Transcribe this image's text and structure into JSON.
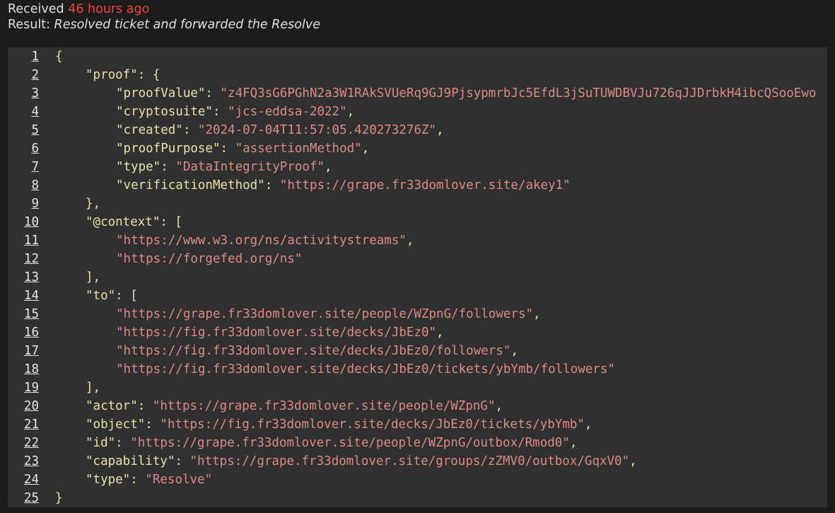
{
  "header": {
    "received_label": "Received",
    "received_time": "46 hours ago",
    "result_label": "Result:",
    "result_value": "Resolved ticket and forwarded the Resolve"
  },
  "code": {
    "lines": [
      {
        "n": "1",
        "indent": 0,
        "parts": [
          [
            "p",
            "{"
          ]
        ]
      },
      {
        "n": "2",
        "indent": 1,
        "parts": [
          [
            "k",
            "\"proof\""
          ],
          [
            "p",
            ": {"
          ]
        ]
      },
      {
        "n": "3",
        "indent": 2,
        "parts": [
          [
            "k",
            "\"proofValue\""
          ],
          [
            "p",
            ": "
          ],
          [
            "s",
            "\"z4FQ3sG6PGhN2a3W1RAkSVUeRq9GJ9PjsypmrbJc5EfdL3jSuTUWDBVJu726qJJDrbkH4ibcQSooEwo"
          ]
        ]
      },
      {
        "n": "4",
        "indent": 2,
        "parts": [
          [
            "k",
            "\"cryptosuite\""
          ],
          [
            "p",
            ": "
          ],
          [
            "s",
            "\"jcs-eddsa-2022\""
          ],
          [
            "p",
            ","
          ]
        ]
      },
      {
        "n": "5",
        "indent": 2,
        "parts": [
          [
            "k",
            "\"created\""
          ],
          [
            "p",
            ": "
          ],
          [
            "s",
            "\"2024-07-04T11:57:05.420273276Z\""
          ],
          [
            "p",
            ","
          ]
        ]
      },
      {
        "n": "6",
        "indent": 2,
        "parts": [
          [
            "k",
            "\"proofPurpose\""
          ],
          [
            "p",
            ": "
          ],
          [
            "s",
            "\"assertionMethod\""
          ],
          [
            "p",
            ","
          ]
        ]
      },
      {
        "n": "7",
        "indent": 2,
        "parts": [
          [
            "k",
            "\"type\""
          ],
          [
            "p",
            ": "
          ],
          [
            "s",
            "\"DataIntegrityProof\""
          ],
          [
            "p",
            ","
          ]
        ]
      },
      {
        "n": "8",
        "indent": 2,
        "parts": [
          [
            "k",
            "\"verificationMethod\""
          ],
          [
            "p",
            ": "
          ],
          [
            "s",
            "\"https://grape.fr33domlover.site/akey1\""
          ]
        ]
      },
      {
        "n": "9",
        "indent": 1,
        "parts": [
          [
            "p",
            "},"
          ]
        ]
      },
      {
        "n": "10",
        "indent": 1,
        "parts": [
          [
            "k",
            "\"@context\""
          ],
          [
            "p",
            ": ["
          ]
        ]
      },
      {
        "n": "11",
        "indent": 2,
        "parts": [
          [
            "s",
            "\"https://www.w3.org/ns/activitystreams\""
          ],
          [
            "p",
            ","
          ]
        ]
      },
      {
        "n": "12",
        "indent": 2,
        "parts": [
          [
            "s",
            "\"https://forgefed.org/ns\""
          ]
        ]
      },
      {
        "n": "13",
        "indent": 1,
        "parts": [
          [
            "p",
            "],"
          ]
        ]
      },
      {
        "n": "14",
        "indent": 1,
        "parts": [
          [
            "k",
            "\"to\""
          ],
          [
            "p",
            ": ["
          ]
        ]
      },
      {
        "n": "15",
        "indent": 2,
        "parts": [
          [
            "s",
            "\"https://grape.fr33domlover.site/people/WZpnG/followers\""
          ],
          [
            "p",
            ","
          ]
        ]
      },
      {
        "n": "16",
        "indent": 2,
        "parts": [
          [
            "s",
            "\"https://fig.fr33domlover.site/decks/JbEz0\""
          ],
          [
            "p",
            ","
          ]
        ]
      },
      {
        "n": "17",
        "indent": 2,
        "parts": [
          [
            "s",
            "\"https://fig.fr33domlover.site/decks/JbEz0/followers\""
          ],
          [
            "p",
            ","
          ]
        ]
      },
      {
        "n": "18",
        "indent": 2,
        "parts": [
          [
            "s",
            "\"https://fig.fr33domlover.site/decks/JbEz0/tickets/ybYmb/followers\""
          ]
        ]
      },
      {
        "n": "19",
        "indent": 1,
        "parts": [
          [
            "p",
            "],"
          ]
        ]
      },
      {
        "n": "20",
        "indent": 1,
        "parts": [
          [
            "k",
            "\"actor\""
          ],
          [
            "p",
            ": "
          ],
          [
            "s",
            "\"https://grape.fr33domlover.site/people/WZpnG\""
          ],
          [
            "p",
            ","
          ]
        ]
      },
      {
        "n": "21",
        "indent": 1,
        "parts": [
          [
            "k",
            "\"object\""
          ],
          [
            "p",
            ": "
          ],
          [
            "s",
            "\"https://fig.fr33domlover.site/decks/JbEz0/tickets/ybYmb\""
          ],
          [
            "p",
            ","
          ]
        ]
      },
      {
        "n": "22",
        "indent": 1,
        "parts": [
          [
            "k",
            "\"id\""
          ],
          [
            "p",
            ": "
          ],
          [
            "s",
            "\"https://grape.fr33domlover.site/people/WZpnG/outbox/Rmod0\""
          ],
          [
            "p",
            ","
          ]
        ]
      },
      {
        "n": "23",
        "indent": 1,
        "parts": [
          [
            "k",
            "\"capability\""
          ],
          [
            "p",
            ": "
          ],
          [
            "s",
            "\"https://grape.fr33domlover.site/groups/zZMV0/outbox/GqxV0\""
          ],
          [
            "p",
            ","
          ]
        ]
      },
      {
        "n": "24",
        "indent": 1,
        "parts": [
          [
            "k",
            "\"type\""
          ],
          [
            "p",
            ": "
          ],
          [
            "s",
            "\"Resolve\""
          ]
        ]
      },
      {
        "n": "25",
        "indent": 0,
        "parts": [
          [
            "p",
            "}"
          ]
        ]
      }
    ]
  }
}
